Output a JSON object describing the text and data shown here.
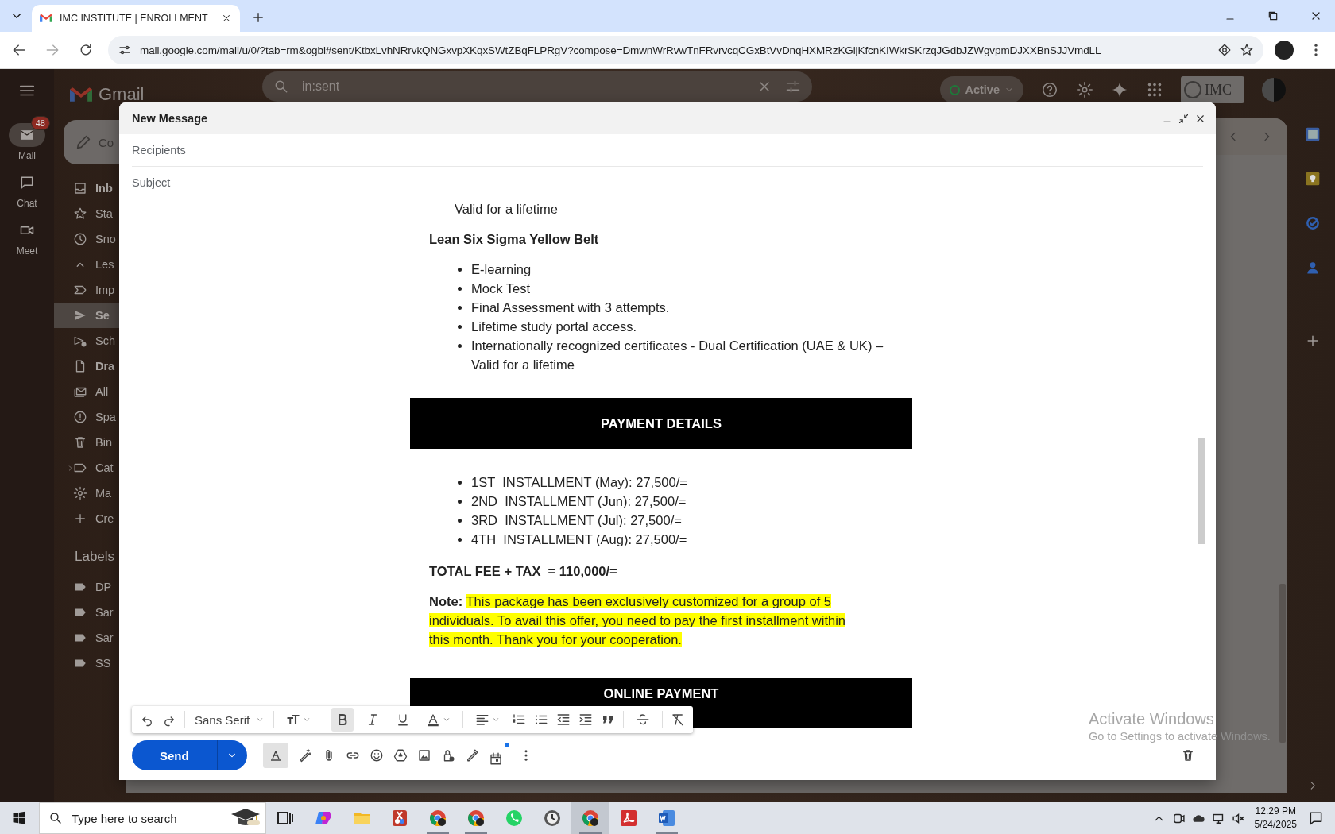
{
  "browser": {
    "tab": {
      "title": "IMC INSTITUTE | ENROLLMENT",
      "selected": true
    },
    "url": "mail.google.com/mail/u/0/?tab=rm&ogbl#sent/KtbxLvhNRrvkQNGxvpXKqxSWtZBqFLPRgV?compose=DmwnWrRvwTnFRvrvcqCGxBtVvDnqHXMRzKGljKfcnKIWkrSKrzqJGdbJZWgvpmDJXXBnSJJVmdLL"
  },
  "gmail": {
    "brand": "Gmail",
    "search": {
      "value": "in:sent"
    },
    "status": "Active",
    "logo_text": "IMC",
    "rail": [
      {
        "label": "Mail",
        "badge": "48",
        "selected": true
      },
      {
        "label": "Chat",
        "selected": false
      },
      {
        "label": "Meet",
        "selected": false
      }
    ],
    "compose_button": "Co",
    "nav": [
      {
        "label": "Inb",
        "unread": true,
        "selected": false
      },
      {
        "label": "Sta",
        "unread": false,
        "selected": false
      },
      {
        "label": "Sno",
        "unread": false,
        "selected": false
      },
      {
        "label": "Les",
        "unread": false,
        "selected": false
      },
      {
        "label": "Imp",
        "unread": false,
        "selected": false
      },
      {
        "label": "Se",
        "unread": false,
        "selected": true
      },
      {
        "label": "Sch",
        "unread": false,
        "selected": false
      },
      {
        "label": "Dra",
        "unread": true,
        "selected": false
      },
      {
        "label": "All",
        "unread": false,
        "selected": false
      },
      {
        "label": "Spa",
        "unread": false,
        "selected": false
      },
      {
        "label": "Bin",
        "unread": false,
        "selected": false
      },
      {
        "label": "Cat",
        "unread": false,
        "selected": false
      },
      {
        "label": "Ma",
        "unread": false,
        "selected": false
      },
      {
        "label": "Cre",
        "unread": false,
        "selected": false
      }
    ],
    "labels_heading": "Labels",
    "labels": [
      {
        "label": "DP"
      },
      {
        "label": "Sar"
      },
      {
        "label": "Sar"
      },
      {
        "label": "SS"
      }
    ]
  },
  "compose": {
    "title": "New Message",
    "recipients": {
      "placeholder": "Recipients"
    },
    "subject": {
      "placeholder": "Subject"
    },
    "body": [
      {
        "kind": "continuation",
        "text": "Valid for a lifetime"
      },
      {
        "kind": "heading",
        "text": "Lean Six Sigma Yellow Belt"
      },
      {
        "kind": "bullets",
        "items": [
          "E-learning",
          "Mock Test",
          "Final Assessment with 3 attempts.",
          "Lifetime study portal access.",
          "Internationally recognized certificates - Dual Certification (UAE & UK) – Valid for a lifetime"
        ]
      },
      {
        "kind": "banner",
        "text": "PAYMENT DETAILS"
      },
      {
        "kind": "bullets",
        "items": [
          "1ST  INSTALLMENT (May): 27,500/=",
          "2ND  INSTALLMENT (Jun): 27,500/=",
          "3RD  INSTALLMENT (Jul): 27,500/=",
          "4TH  INSTALLMENT (Aug): 27,500/="
        ]
      },
      {
        "kind": "heading",
        "text": "TOTAL FEE + TAX  = 110,000/="
      },
      {
        "kind": "note",
        "label": "Note:",
        "text": "This package has been exclusively customized for a group of 5 individuals. To avail this offer, you need to pay the first installment within this month. Thank you for your cooperation."
      },
      {
        "kind": "banner",
        "text": "ONLINE PAYMENT"
      }
    ],
    "format_toolbar": {
      "font": "Sans Serif",
      "bold": true,
      "italic": false,
      "underline": false,
      "strikethrough": false
    },
    "send": "Send",
    "formatting_on": true,
    "schedule_dot": true
  },
  "watermark": {
    "title": "Activate Windows",
    "text": "Go to Settings to activate Windows."
  },
  "taskbar": {
    "search": {
      "placeholder": "Type here to search"
    },
    "apps": [
      {
        "kind": "taskview",
        "running": false,
        "selected": false
      },
      {
        "kind": "copilot",
        "running": false,
        "selected": false
      },
      {
        "kind": "folder",
        "running": false,
        "selected": false
      },
      {
        "kind": "snip",
        "running": false,
        "selected": false
      },
      {
        "kind": "chrome",
        "running": true,
        "selected": false
      },
      {
        "kind": "chrome",
        "running": true,
        "selected": false
      },
      {
        "kind": "whatsapp",
        "running": false,
        "selected": false
      },
      {
        "kind": "clockapp",
        "running": false,
        "selected": false
      },
      {
        "kind": "chrome",
        "running": true,
        "selected": true
      },
      {
        "kind": "pdf",
        "running": false,
        "selected": false
      },
      {
        "kind": "word",
        "running": true,
        "selected": false
      }
    ],
    "time": "12:29 PM",
    "date": "5/24/2025"
  }
}
